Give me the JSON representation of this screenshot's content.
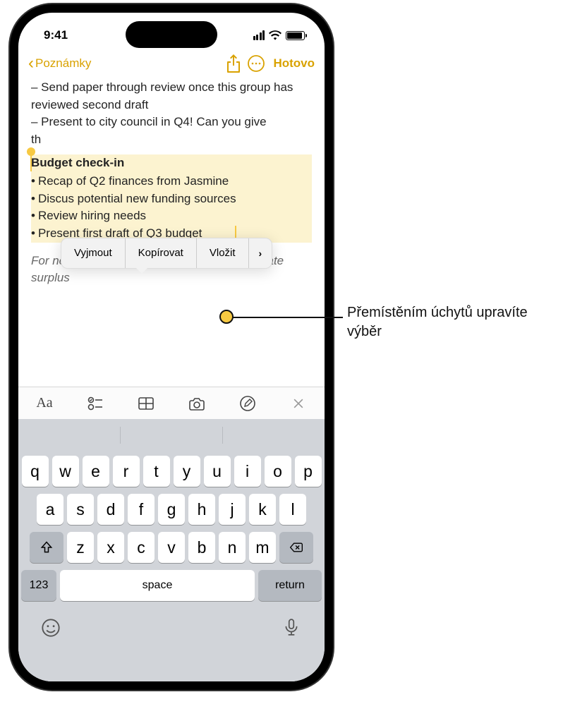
{
  "status": {
    "time": "9:41"
  },
  "nav": {
    "back": "Poznámky",
    "done": "Hotovo"
  },
  "note": {
    "line1": "– Send paper through review once this group has reviewed second draft",
    "line2": "– Present to city council in Q4! Can you give",
    "line2b": "th",
    "highlight_title": "Budget check-in",
    "hl1": "Recap of Q2 finances from Jasmine",
    "hl2": "Discus potential new funding sources",
    "hl3": "Review hiring needs",
    "hl4": "Present first draft of Q3 budget",
    "italic": "For next meeting: discussion on how to allocate surplus"
  },
  "context_menu": {
    "cut": "Vyjmout",
    "copy": "Kopírovat",
    "paste": "Vložit"
  },
  "keyboard": {
    "row1": [
      "q",
      "w",
      "e",
      "r",
      "t",
      "y",
      "u",
      "i",
      "o",
      "p"
    ],
    "row2": [
      "a",
      "s",
      "d",
      "f",
      "g",
      "h",
      "j",
      "k",
      "l"
    ],
    "row3": [
      "z",
      "x",
      "c",
      "v",
      "b",
      "n",
      "m"
    ],
    "num": "123",
    "space": "space",
    "return": "return"
  },
  "callout": "Přemístěním úchytů upravíte výběr"
}
